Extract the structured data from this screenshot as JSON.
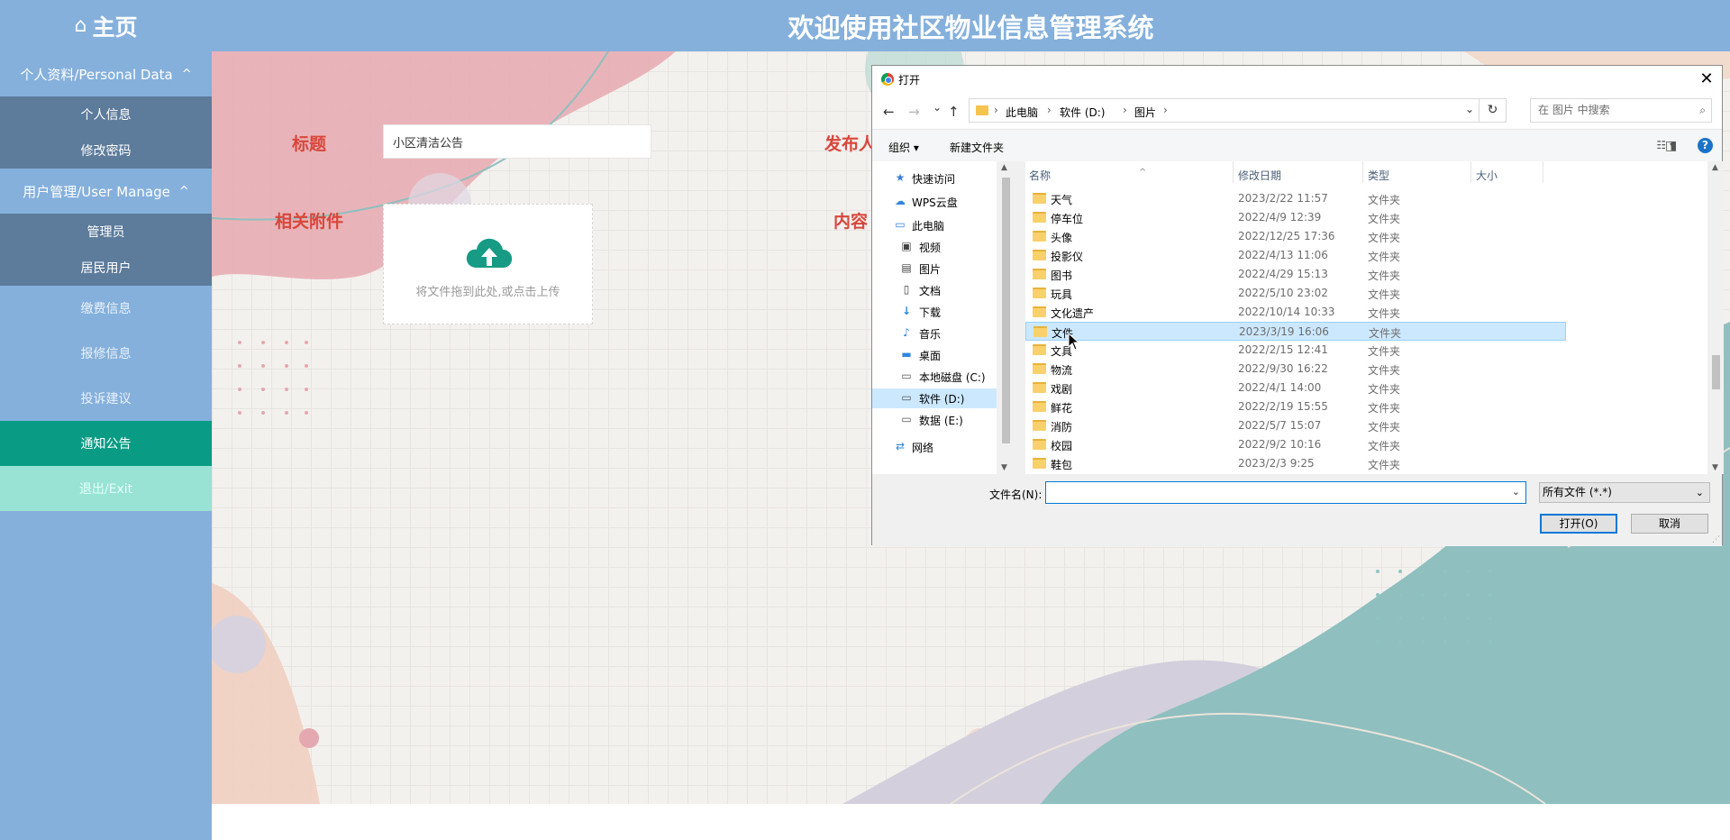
{
  "header": {
    "home_icon": "⌂",
    "home_label": "主页",
    "site_title": "欢迎使用社区物业信息管理系统"
  },
  "sidebar": {
    "groups": [
      {
        "label": "个人资料/Personal Data",
        "caret": "^",
        "items": [
          "个人信息",
          "修改密码"
        ]
      },
      {
        "label": "用户管理/User Manage",
        "caret": "^",
        "items": [
          "管理员",
          "居民用户"
        ]
      }
    ],
    "items": [
      "缴费信息",
      "报修信息",
      "投诉建议",
      "通知公告",
      "退出/Exit"
    ],
    "active_item": "通知公告"
  },
  "form": {
    "title_label": "标题",
    "title_value": "小区清洁公告",
    "publisher_label": "发布人",
    "attachment_label": "相关附件",
    "content_label": "内容",
    "upload_hint": "将文件拖到此处,或点击上传"
  },
  "colors": {
    "sidebar": "#85b0dc",
    "sidebar_sub": "#5d7b9b",
    "active": "#0a9b84",
    "exit": "#98e3d4",
    "label_red": "#d9463b",
    "upload_icon": "#179b84"
  },
  "dialog": {
    "title": "打开",
    "close": "✕",
    "nav": {
      "back": "←",
      "forward": "→",
      "recent": "⌄",
      "up": "↑"
    },
    "breadcrumb": [
      "此电脑",
      "软件 (D:)",
      "图片"
    ],
    "breadcrumb_sep": "›",
    "address_dropdown": "⌄",
    "refresh": "↻",
    "search_placeholder": "在 图片 中搜索",
    "search_icon": "⌕",
    "toolbar": {
      "organize": "组织 ▾",
      "new_folder": "新建文件夹",
      "view_icon": "☷ ▾",
      "pane_icon": "◨",
      "help": "?"
    },
    "nav_pane": [
      {
        "icon": "★",
        "label": "快速访问"
      },
      {
        "icon": "☁",
        "label": "WPS云盘"
      },
      {
        "icon": "▭",
        "label": "此电脑"
      },
      {
        "icon": "▣",
        "label": "视频"
      },
      {
        "icon": "▤",
        "label": "图片"
      },
      {
        "icon": "▯",
        "label": "文档"
      },
      {
        "icon": "↓",
        "label": "下载"
      },
      {
        "icon": "♪",
        "label": "音乐"
      },
      {
        "icon": "▬",
        "label": "桌面"
      },
      {
        "icon": "▭",
        "label": "本地磁盘 (C:)"
      },
      {
        "icon": "▭",
        "label": "软件 (D:)"
      },
      {
        "icon": "▭",
        "label": "数据 (E:)"
      },
      {
        "icon": "⇄",
        "label": "网络"
      }
    ],
    "nav_selected": "软件 (D:)",
    "columns": {
      "name": "名称",
      "date": "修改日期",
      "type": "类型",
      "size": "大小",
      "sort": "^"
    },
    "files": [
      {
        "name": "天气",
        "date": "2023/2/22 11:57",
        "type": "文件夹"
      },
      {
        "name": "停车位",
        "date": "2022/4/9 12:39",
        "type": "文件夹"
      },
      {
        "name": "头像",
        "date": "2022/12/25 17:36",
        "type": "文件夹"
      },
      {
        "name": "投影仪",
        "date": "2022/4/13 11:06",
        "type": "文件夹"
      },
      {
        "name": "图书",
        "date": "2022/4/29 15:13",
        "type": "文件夹"
      },
      {
        "name": "玩具",
        "date": "2022/5/10 23:02",
        "type": "文件夹"
      },
      {
        "name": "文化遗产",
        "date": "2022/10/14 10:33",
        "type": "文件夹"
      },
      {
        "name": "文件",
        "date": "2023/3/19 16:06",
        "type": "文件夹"
      },
      {
        "name": "文具",
        "date": "2022/2/15 12:41",
        "type": "文件夹"
      },
      {
        "name": "物流",
        "date": "2022/9/30 16:22",
        "type": "文件夹"
      },
      {
        "name": "戏剧",
        "date": "2022/4/1 14:00",
        "type": "文件夹"
      },
      {
        "name": "鲜花",
        "date": "2022/2/19 15:55",
        "type": "文件夹"
      },
      {
        "name": "消防",
        "date": "2022/5/7 15:07",
        "type": "文件夹"
      },
      {
        "name": "校园",
        "date": "2022/9/2 10:16",
        "type": "文件夹"
      },
      {
        "name": "鞋包",
        "date": "2023/2/3 9:25",
        "type": "文件夹"
      }
    ],
    "selected_file": "文件",
    "filename_label": "文件名(N):",
    "filename_value": "",
    "filetype_value": "所有文件 (*.*)",
    "dropdown": "⌄",
    "open_button": "打开(O)",
    "cancel_button": "取消",
    "scroll_up": "▲",
    "scroll_down": "▼",
    "grip": "⋰"
  }
}
